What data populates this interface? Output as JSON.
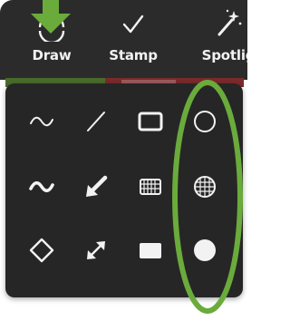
{
  "toolbar": {
    "items": [
      {
        "label": "Draw",
        "icon": "pencil-circle-icon"
      },
      {
        "label": "Stamp",
        "icon": "checkmark-icon"
      },
      {
        "label": "Spotlig",
        "icon": "magic-wand-icon"
      }
    ]
  },
  "shapes_panel": {
    "rows": [
      [
        "thin-squiggle-line-icon",
        "thin-straight-line-icon",
        "rectangle-outline-icon",
        "circle-outline-icon"
      ],
      [
        "thick-squiggle-line-icon",
        "arrow-icon",
        "rectangle-pattern-fill-icon",
        "circle-pattern-fill-icon"
      ],
      [
        "diamond-outline-icon",
        "double-arrow-icon",
        "rectangle-solid-icon",
        "circle-solid-icon"
      ]
    ]
  },
  "colors": {
    "toolbar_bg": "#2b2b2b",
    "panel_bg": "#262626",
    "icon": "#f2f2f2",
    "annotation_green": "#6aab3c"
  }
}
